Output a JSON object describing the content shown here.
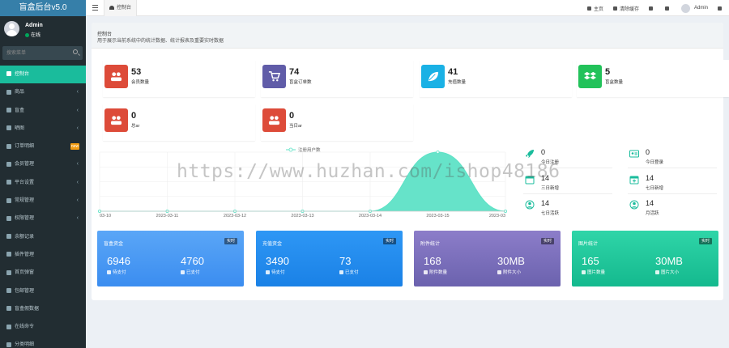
{
  "logo": "盲盒后台v5.0",
  "user": {
    "name": "Admin",
    "status": "在线"
  },
  "sidebar_search_placeholder": "搜索菜单",
  "menu": [
    {
      "label": "控制台",
      "active": true
    },
    {
      "label": "商品",
      "chevron": "‹"
    },
    {
      "label": "盲盒",
      "chevron": "‹"
    },
    {
      "label": "晒图",
      "chevron": "‹"
    },
    {
      "label": "订单明细",
      "badge": "new"
    },
    {
      "label": "会员管理",
      "chevron": "‹"
    },
    {
      "label": "平台设置",
      "chevron": "‹"
    },
    {
      "label": "常规管理",
      "chevron": "‹"
    },
    {
      "label": "权限管理",
      "chevron": "‹"
    },
    {
      "label": "余额记录"
    },
    {
      "label": "插件管理"
    },
    {
      "label": "首页弹窗"
    },
    {
      "label": "包邮管理"
    },
    {
      "label": "盲盒假数据"
    },
    {
      "label": "在线命令"
    },
    {
      "label": "分类明细"
    }
  ],
  "navbar": {
    "tab": "控制台",
    "links": [
      "主页",
      "清除缓存"
    ],
    "user": "Admin"
  },
  "content": {
    "title": "控制台",
    "description": "用于展示当前系统中的统计数据、统计报表及重要实时数据"
  },
  "stats": [
    {
      "value": "53",
      "label": "会员数量",
      "color": "#dd4b39"
    },
    {
      "value": "74",
      "label": "盲盒订单数",
      "color": "#605ca8"
    },
    {
      "value": "41",
      "label": "充值数量",
      "color": "#1ab1e5"
    },
    {
      "value": "5",
      "label": "盲盒数量",
      "color": "#22c25a"
    },
    {
      "value": "0",
      "label": "总ar",
      "color": "#dd4b39"
    },
    {
      "value": "0",
      "label": "当日ar",
      "color": "#dd4b39"
    }
  ],
  "chart_data": {
    "type": "area",
    "legend": "注册用户数",
    "categories": [
      "2023-03-10",
      "2023-03-11",
      "2023-03-12",
      "2023-03-13",
      "2023-03-14",
      "2023-03-15",
      "2023-03-16"
    ],
    "tick_labels": [
      "03-10",
      "2023-03-11",
      "2023-03-12",
      "2023-03-13",
      "2023-03-14",
      "2023-03-15",
      "2023-03"
    ],
    "values": [
      0,
      0,
      0,
      0,
      0,
      14,
      0
    ],
    "ylim": [
      0,
      14
    ],
    "smooth": true,
    "color": "#5ee2c6",
    "grid": true
  },
  "mini_stats": [
    {
      "value": "0",
      "label": "今日注册",
      "icon": "rocket-icon"
    },
    {
      "value": "0",
      "label": "今日登录",
      "icon": "id-card-icon"
    },
    {
      "value": "14",
      "label": "三日新增",
      "icon": "calendar-icon"
    },
    {
      "value": "14",
      "label": "七日新增",
      "icon": "calendar-plus-icon"
    },
    {
      "value": "14",
      "label": "七日活跃",
      "icon": "user-circle-icon"
    },
    {
      "value": "14",
      "label": "月活跃",
      "icon": "user-circle-icon"
    }
  ],
  "cards": [
    {
      "title": "盲盒资金",
      "badge": "实时",
      "v1": "6946",
      "v2": "4760",
      "l1": "待支付",
      "l2": "已支付",
      "from": "#5aa6f7",
      "to": "#3b8df0"
    },
    {
      "title": "充值资金",
      "badge": "实时",
      "v1": "3490",
      "v2": "73",
      "l1": "待支付",
      "l2": "已支付",
      "from": "#2e97f5",
      "to": "#1a81e6"
    },
    {
      "title": "附件统计",
      "badge": "实时",
      "v1": "168",
      "v2": "30MB",
      "l1": "附件数量",
      "l2": "附件大小",
      "from": "#8c7dc9",
      "to": "#6b62ae"
    },
    {
      "title": "图片统计",
      "badge": "实时",
      "v1": "165",
      "v2": "30MB",
      "l1": "图片数量",
      "l2": "图片大小",
      "from": "#2fd5a8",
      "to": "#14b98e"
    }
  ],
  "watermark": "https://www.huzhan.com/ishop48186"
}
